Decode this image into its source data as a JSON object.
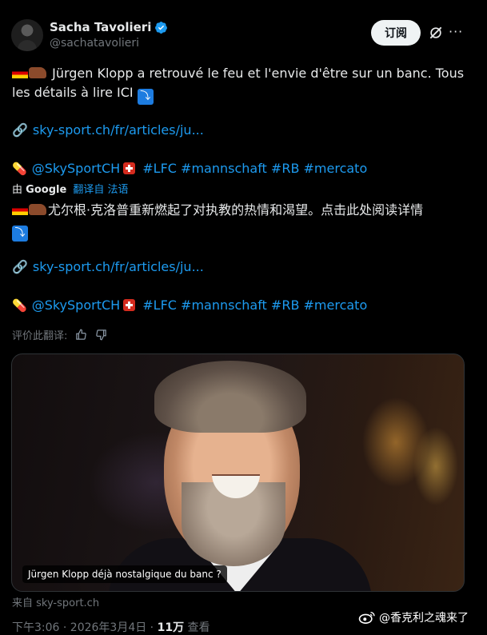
{
  "author": {
    "name": "Sacha Tavolieri",
    "handle": "@sachatavolieri"
  },
  "actions": {
    "subscribe_label": "订阅"
  },
  "original_post": {
    "line1": "Jürgen Klopp a retrouvé le feu et l'envie d'être sur un banc. Tous",
    "line2": "les détails à lire ICI",
    "link": "sky-sport.ch/fr/articles/ju...",
    "mention": "@SkySportCH",
    "hashtags": "#LFC #mannschaft #RB #mercato"
  },
  "translation_bar": {
    "prefix": "由",
    "provider": "Google",
    "label": "翻译自 法语"
  },
  "translated_post": {
    "line1": "尤尔根·克洛普重新燃起了对执教的热情和渴望。点击此处阅读详情",
    "link": "sky-sport.ch/fr/articles/ju...",
    "mention": "@SkySportCH",
    "hashtags": "#LFC #mannschaft #RB #mercato"
  },
  "rate_translation": {
    "label": "评价此翻译:"
  },
  "media": {
    "caption": "Jürgen Klopp déjà nostalgique du banc ?",
    "source": "来自 sky-sport.ch"
  },
  "meta": {
    "time_prefix": "下午3:06 · 2026年3月4日 · ",
    "views_count": "11万",
    "views_label": " 查看"
  },
  "watermark": {
    "text": "@香克利之魂来了"
  },
  "colors": {
    "background": "#000000",
    "link": "#1d9bf0",
    "muted": "#71767b",
    "verified": "#1d9bf0"
  }
}
